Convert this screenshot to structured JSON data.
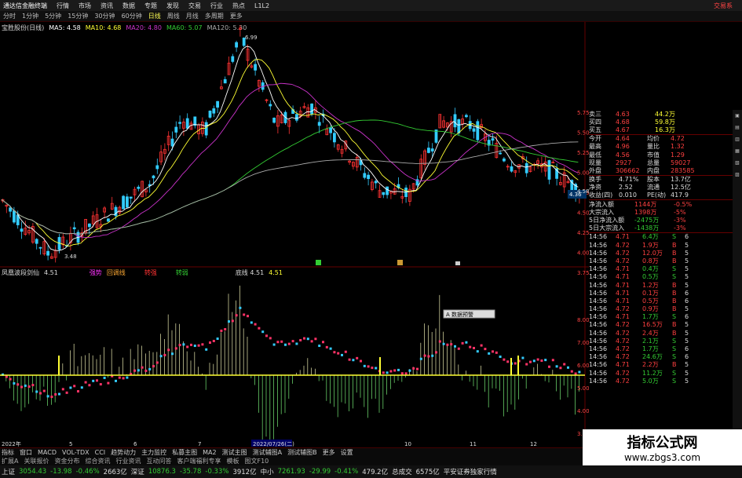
{
  "titlebar": {
    "app": "通达信金融终端",
    "menus": [
      "行情",
      "市场",
      "资讯",
      "数据",
      "专题",
      "发现",
      "交易",
      "行业",
      "热点",
      "L1L2"
    ],
    "right": "交易系"
  },
  "toolbar": {
    "periods": [
      "分时",
      "1分钟",
      "5分钟",
      "15分钟",
      "30分钟",
      "60分钟",
      "日线",
      "周线",
      "月线",
      "多周期",
      "更多"
    ],
    "active": "日线"
  },
  "main_ma": {
    "stock": "宝胜股份(日线)",
    "ma5": "MA5: 4.58",
    "ma10": "MA10: 4.68",
    "ma20": "MA20: 4.80",
    "ma60": "MA60: 5.07",
    "ma120": "MA120: 5.30"
  },
  "price_axis": [
    "5.75",
    "5.50",
    "5.25",
    "5.00",
    "4.75",
    "4.50",
    "4.25",
    "4.00",
    "3.75"
  ],
  "price_labels": {
    "high": "6.99",
    "low": "3.48",
    "last": "4.36",
    "right": "4.58"
  },
  "indicator": {
    "name": "凤凰波段剑仙",
    "v1": "4.51",
    "labels": [
      "强势",
      "回调线",
      "转强",
      "转弱",
      "底线 4.51",
      "4.51"
    ],
    "tooltip": "A 数据预警"
  },
  "ind_axis": [
    "8.00",
    "7.00",
    "6.00",
    "5.00",
    "4.00",
    "3.00"
  ],
  "date_axis": [
    "2022年",
    "5",
    "6",
    "7",
    "2022/07/26(二)",
    "10",
    "11",
    "12"
  ],
  "quote": {
    "sell_rows": [
      {
        "label": "卖三",
        "price": "4.63",
        "vol": "44.2万"
      },
      {
        "label": "买四",
        "price": "4.68",
        "vol": "59.8万"
      },
      {
        "label": "买五",
        "price": "4.67",
        "vol": "16.3万"
      }
    ],
    "info_rows": [
      [
        "今开",
        "4.64",
        "均价",
        "4.72"
      ],
      [
        "最高",
        "4.96",
        "量比",
        "1.32"
      ],
      [
        "最低",
        "4.56",
        "市值",
        "1.29"
      ],
      [
        "现量",
        "2927",
        "总量",
        "59027"
      ],
      [
        "外盘",
        "306662",
        "内盘",
        "283585"
      ]
    ],
    "info_rows2": [
      [
        "换手",
        "4.71%",
        "股本",
        "13.7亿"
      ],
      [
        "净资",
        "2.52",
        "流通",
        "12.5亿"
      ],
      [
        "收益(四)",
        "0.010",
        "PE(动)",
        "417.9"
      ]
    ],
    "flow_rows": [
      [
        "净流入额",
        "1144万",
        "-0.5%"
      ],
      [
        "大宗流入",
        "1398万",
        "-5%"
      ],
      [
        "5日净流入额",
        "-2475万",
        "-3%"
      ],
      [
        "5日大宗流入",
        "-1438万",
        "-3%"
      ]
    ],
    "ticks": [
      [
        "14:56",
        "4.71",
        "6.4万",
        "S",
        "6"
      ],
      [
        "14:56",
        "4.72",
        "1.9万",
        "B",
        "5"
      ],
      [
        "14:56",
        "4.72",
        "12.0万",
        "B",
        "5"
      ],
      [
        "14:56",
        "4.72",
        "0.8万",
        "B",
        "5"
      ],
      [
        "14:56",
        "4.71",
        "0.4万",
        "S",
        "5"
      ],
      [
        "14:56",
        "4.71",
        "0.5万",
        "S",
        "5"
      ],
      [
        "14:56",
        "4.71",
        "1.2万",
        "B",
        "5"
      ],
      [
        "14:56",
        "4.71",
        "0.1万",
        "B",
        "6"
      ],
      [
        "14:56",
        "4.71",
        "0.5万",
        "B",
        "6"
      ],
      [
        "14:56",
        "4.72",
        "0.9万",
        "B",
        "5"
      ],
      [
        "14:56",
        "4.71",
        "1.7万",
        "S",
        "6"
      ],
      [
        "14:56",
        "4.72",
        "16.5万",
        "B",
        "5"
      ],
      [
        "14:56",
        "4.72",
        "2.4万",
        "B",
        "5"
      ],
      [
        "14:56",
        "4.72",
        "2.1万",
        "S",
        "5"
      ],
      [
        "14:56",
        "4.72",
        "1.7万",
        "S",
        "6"
      ],
      [
        "14:56",
        "4.72",
        "24.6万",
        "S",
        "6"
      ],
      [
        "14:56",
        "4.71",
        "2.2万",
        "B",
        "5"
      ],
      [
        "14:56",
        "4.72",
        "11.2万",
        "S",
        "5"
      ],
      [
        "14:56",
        "4.72",
        "5.0万",
        "S",
        "5"
      ]
    ]
  },
  "bottombar1": [
    "指标",
    "窗口",
    "MACD",
    "VOL-TDX",
    "CCI",
    "趋势动力",
    "主力监控",
    "私募主图",
    "MA2",
    "测试主图",
    "测试辅图A",
    "测试辅图B",
    "更多",
    "设置"
  ],
  "bottombar2": [
    "扩展A",
    "关联报价",
    "资金分布",
    "综合资讯",
    "行业资讯",
    "互动问答",
    "客户端福利专享",
    "模板",
    "图文F10"
  ],
  "status": {
    "sh_label": "上证",
    "sh_val": "3054.43",
    "sh_chg": "-13.98",
    "sh_pct": "-0.46%",
    "sh_amt": "2663亿",
    "sz_label": "深证",
    "sz_val": "10876.3",
    "sz_chg": "-35.78",
    "sz_pct": "-0.33%",
    "sz_amt": "3912亿",
    "zx_label": "中小",
    "zx_val": "7261.93",
    "zx_chg": "-29.99",
    "zx_pct": "-0.41%",
    "zx_amt": "479.2亿",
    "total_label": "总成交",
    "total_val": "6575亿",
    "broker": "平安证券独家行情"
  },
  "watermark": {
    "title": "指标公式网",
    "url": "www.zbgs3.com"
  },
  "colors": {
    "up": "#ff3333",
    "down": "#33ccff",
    "ma5": "#ffffff",
    "ma10": "#ffff33",
    "ma20": "#cc33cc",
    "ma60": "#33cc33",
    "ma120": "#aaaaaa"
  }
}
